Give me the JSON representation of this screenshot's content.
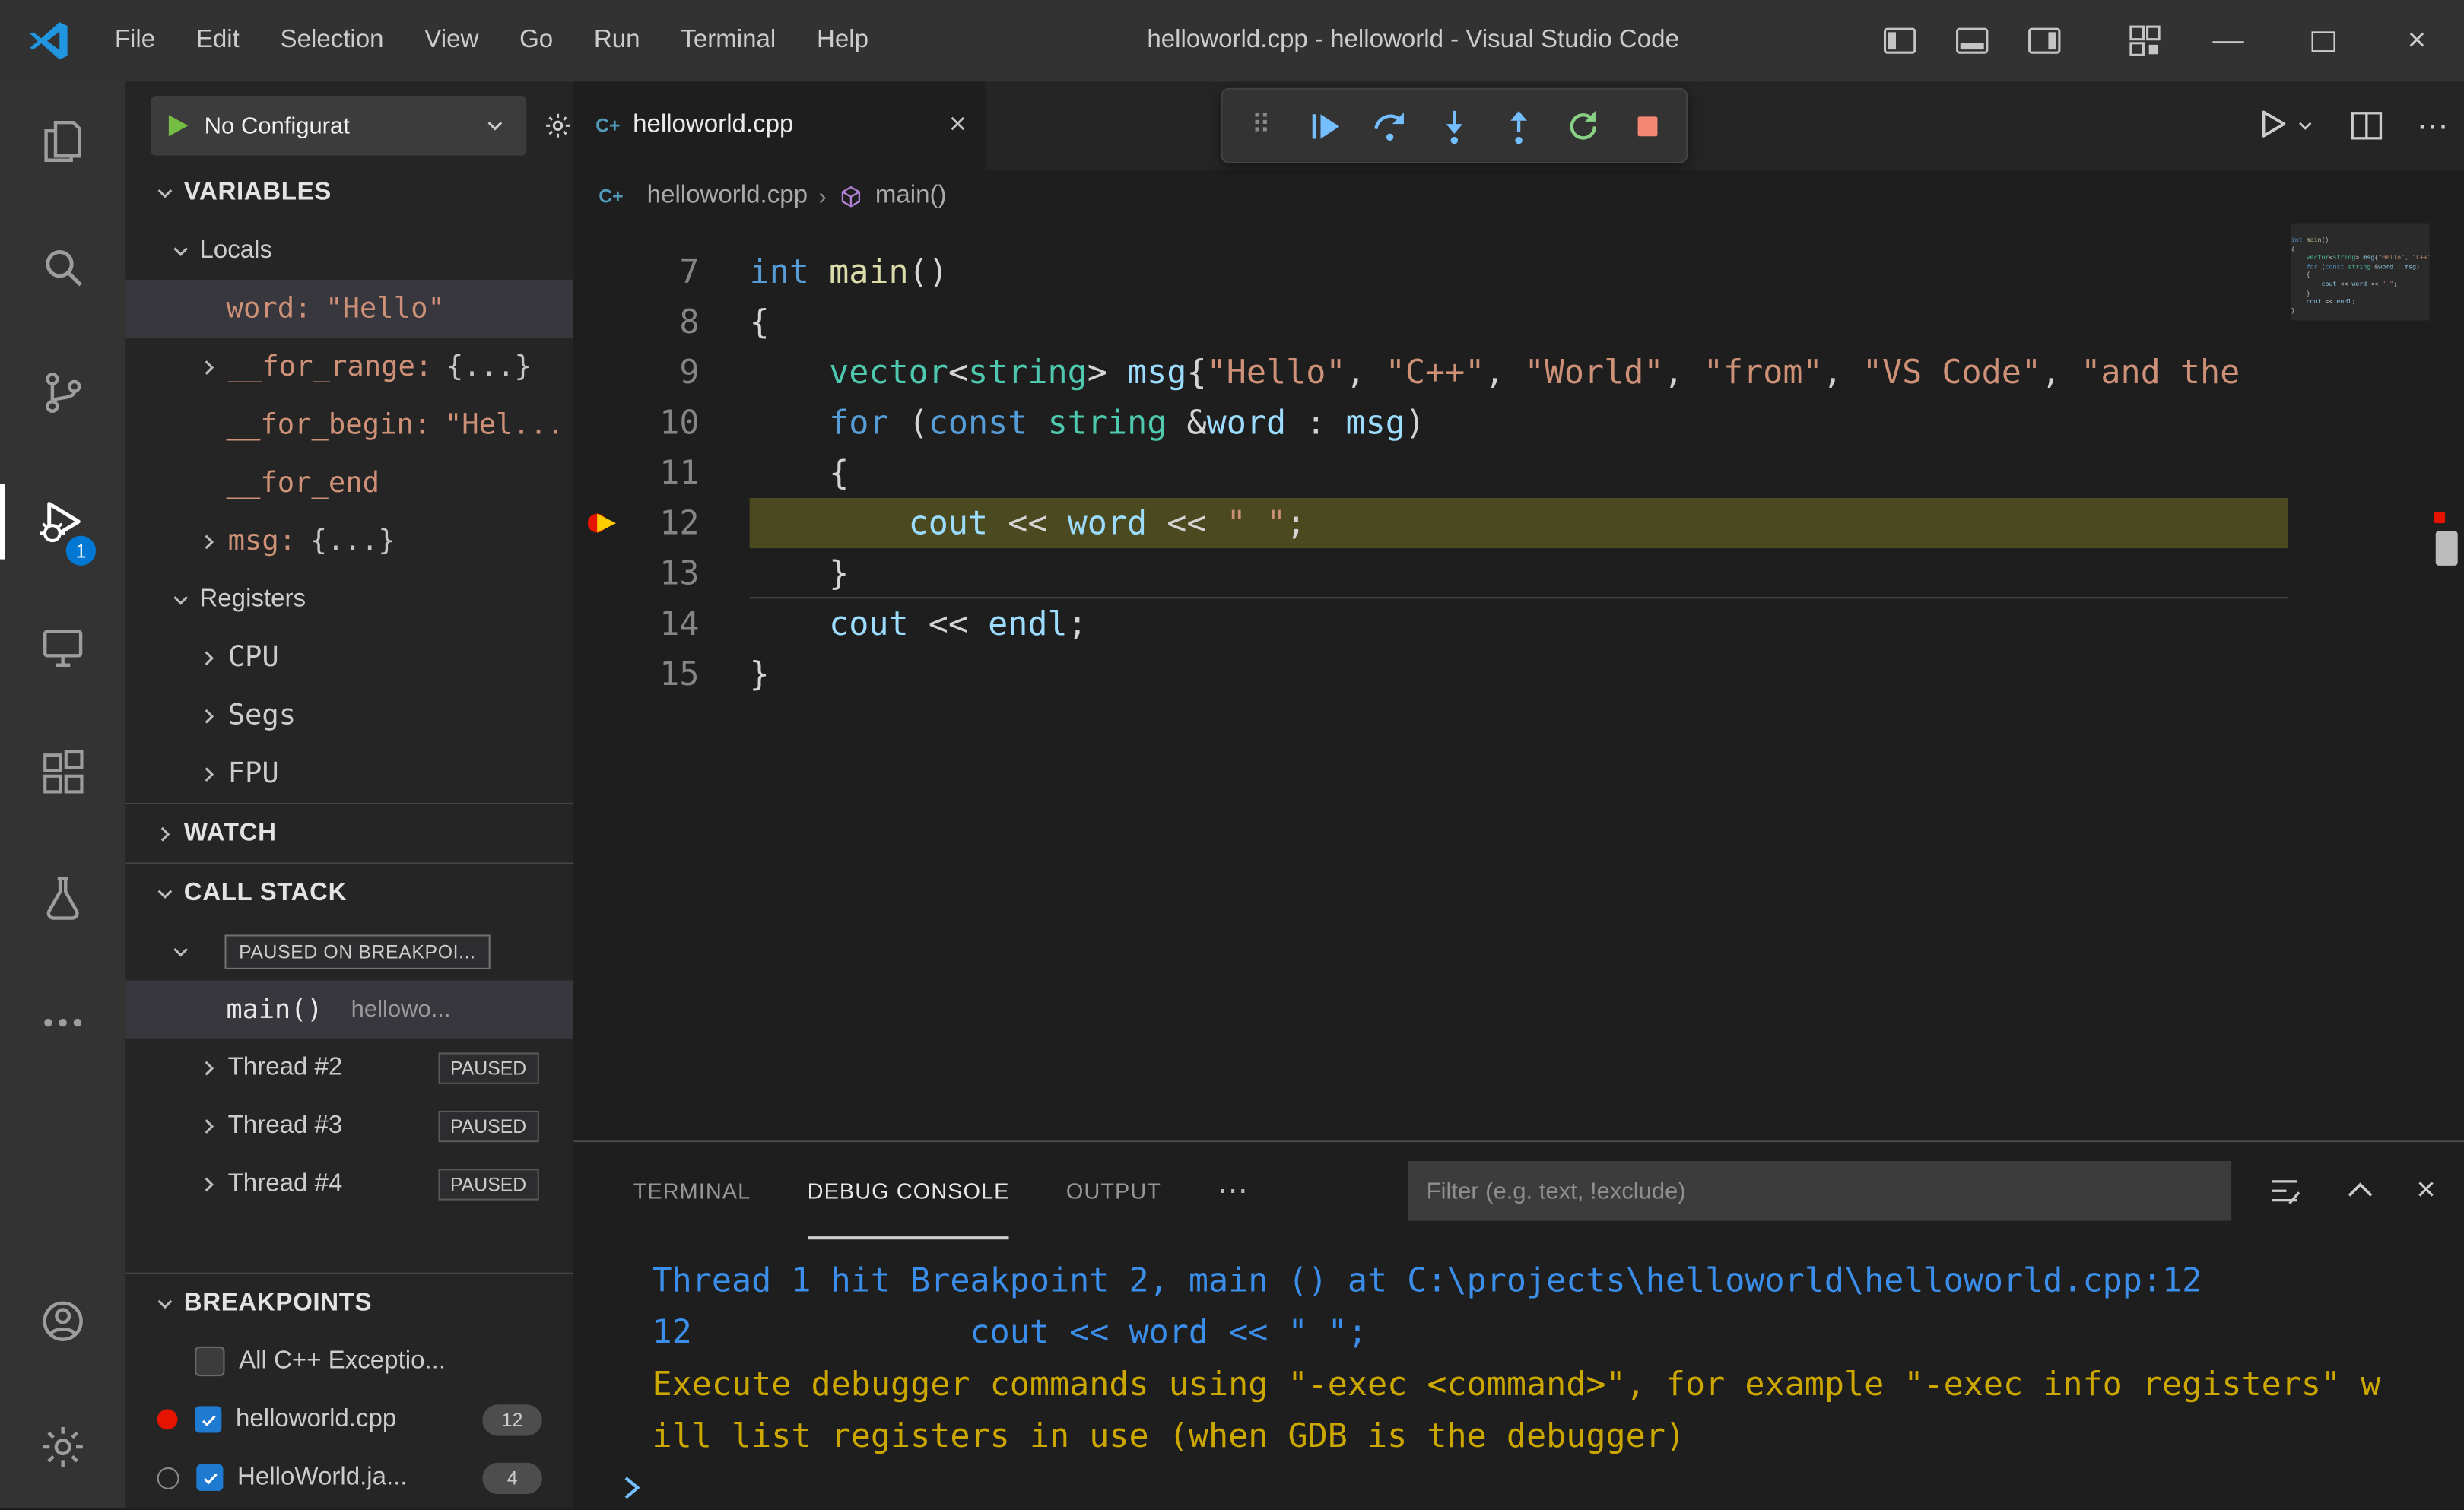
{
  "colors": {
    "accent": "#007acc",
    "activity_badge": "#0078d4",
    "exec_line_highlight": "#4b491f",
    "debug_console_info": "#3b8eea",
    "debug_console_warn": "#cca700",
    "breakpoint_red": "#e51400",
    "stop_red": "#f48771",
    "restart_green": "#89d185",
    "step_blue": "#75beff"
  },
  "glyphs": {
    "more_h": "⋯",
    "grip": "⠿",
    "close": "×",
    "minimize": "—"
  },
  "title_bar": {
    "menus": [
      "File",
      "Edit",
      "Selection",
      "View",
      "Go",
      "Run",
      "Terminal",
      "Help"
    ],
    "title": "helloworld.cpp - helloworld - Visual Studio Code"
  },
  "activity_bar": {
    "debug_badge": "1"
  },
  "sidebar": {
    "config_label": "No Configurat",
    "variables_header": "VARIABLES",
    "locals_label": "Locals",
    "variables": {
      "word": {
        "name": "word:",
        "value": "\"Hello\""
      },
      "for_range": {
        "name": "__for_range:",
        "value": "{...}"
      },
      "for_begin": {
        "name": "__for_begin:",
        "value": "\"Hel..."
      },
      "for_end": {
        "name": "__for_end",
        "value": ""
      },
      "msg": {
        "name": "msg:",
        "value": "{...}"
      }
    },
    "registers_label": "Registers",
    "registers": [
      "CPU",
      "Segs",
      "FPU"
    ],
    "watch_header": "WATCH",
    "callstack_header": "CALL STACK",
    "paused_label": "PAUSED ON BREAKPOI...",
    "frame": {
      "fn": "main()",
      "file": "hellowo..."
    },
    "threads": [
      {
        "label": "Thread #2",
        "status": "PAUSED"
      },
      {
        "label": "Thread #3",
        "status": "PAUSED"
      },
      {
        "label": "Thread #4",
        "status": "PAUSED"
      }
    ],
    "breakpoints_header": "BREAKPOINTS",
    "breakpoints": [
      {
        "label": "All C++ Exceptio...",
        "count": ""
      },
      {
        "label": "helloworld.cpp",
        "count": "12"
      },
      {
        "label": "HelloWorld.ja...",
        "count": "4"
      }
    ]
  },
  "editor": {
    "tab_label": "helloworld.cpp",
    "cpp_icon_glyph": "C+",
    "breadcrumb_file": "helloworld.cpp",
    "breadcrumb_symbol": "main()",
    "code_lines": [
      {
        "num": "7",
        "segments": [
          {
            "c": "kw",
            "t": "int"
          },
          {
            "c": "pun",
            "t": " "
          },
          {
            "c": "fn",
            "t": "main"
          },
          {
            "c": "pun",
            "t": "()"
          }
        ]
      },
      {
        "num": "8",
        "segments": [
          {
            "c": "pun",
            "t": "{"
          }
        ]
      },
      {
        "num": "9",
        "segments": [
          {
            "c": "pun",
            "t": "    "
          },
          {
            "c": "type",
            "t": "vector"
          },
          {
            "c": "pun",
            "t": "<"
          },
          {
            "c": "type",
            "t": "string"
          },
          {
            "c": "pun",
            "t": "> "
          },
          {
            "c": "var",
            "t": "msg"
          },
          {
            "c": "pun",
            "t": "{"
          },
          {
            "c": "str",
            "t": "\"Hello\""
          },
          {
            "c": "pun",
            "t": ", "
          },
          {
            "c": "str",
            "t": "\"C++\""
          },
          {
            "c": "pun",
            "t": ", "
          },
          {
            "c": "str",
            "t": "\"World\""
          },
          {
            "c": "pun",
            "t": ", "
          },
          {
            "c": "str",
            "t": "\"from\""
          },
          {
            "c": "pun",
            "t": ", "
          },
          {
            "c": "str",
            "t": "\"VS Code\""
          },
          {
            "c": "pun",
            "t": ", "
          },
          {
            "c": "str",
            "t": "\"and the"
          }
        ]
      },
      {
        "num": "10",
        "segments": [
          {
            "c": "pun",
            "t": "    "
          },
          {
            "c": "kw",
            "t": "for"
          },
          {
            "c": "pun",
            "t": " ("
          },
          {
            "c": "kw",
            "t": "const"
          },
          {
            "c": "pun",
            "t": " "
          },
          {
            "c": "type",
            "t": "string"
          },
          {
            "c": "pun",
            "t": " &"
          },
          {
            "c": "var",
            "t": "word"
          },
          {
            "c": "pun",
            "t": " : "
          },
          {
            "c": "var",
            "t": "msg"
          },
          {
            "c": "pun",
            "t": ")"
          }
        ]
      },
      {
        "num": "11",
        "segments": [
          {
            "c": "pun",
            "t": "    {"
          }
        ]
      },
      {
        "num": "12",
        "current": true,
        "breakpoint": true,
        "segments": [
          {
            "c": "pun",
            "t": "        "
          },
          {
            "c": "var",
            "t": "cout"
          },
          {
            "c": "pun",
            "t": " << "
          },
          {
            "c": "var",
            "t": "word"
          },
          {
            "c": "pun",
            "t": " << "
          },
          {
            "c": "str",
            "t": "\" \""
          },
          {
            "c": "pun",
            "t": ";"
          }
        ]
      },
      {
        "num": "13",
        "border": true,
        "segments": [
          {
            "c": "pun",
            "t": "    }"
          }
        ]
      },
      {
        "num": "14",
        "segments": [
          {
            "c": "pun",
            "t": "    "
          },
          {
            "c": "var",
            "t": "cout"
          },
          {
            "c": "pun",
            "t": " << "
          },
          {
            "c": "var",
            "t": "endl"
          },
          {
            "c": "pun",
            "t": ";"
          }
        ]
      },
      {
        "num": "15",
        "segments": [
          {
            "c": "pun",
            "t": "}"
          }
        ]
      }
    ]
  },
  "panel": {
    "tabs": [
      "TERMINAL",
      "DEBUG CONSOLE",
      "OUTPUT"
    ],
    "filter_placeholder": "Filter (e.g. text, !exclude)",
    "console_lines": [
      {
        "c": "blue",
        "t": "Thread 1 hit Breakpoint 2, main () at C:\\projects\\helloworld\\helloworld.cpp:12"
      },
      {
        "c": "blue",
        "t": "12              cout << word << \" \";"
      },
      {
        "c": "yellow",
        "t": "Execute debugger commands using \"-exec <command>\", for example \"-exec info registers\" w"
      },
      {
        "c": "yellow",
        "t": "ill list registers in use (when GDB is the debugger)"
      }
    ]
  }
}
